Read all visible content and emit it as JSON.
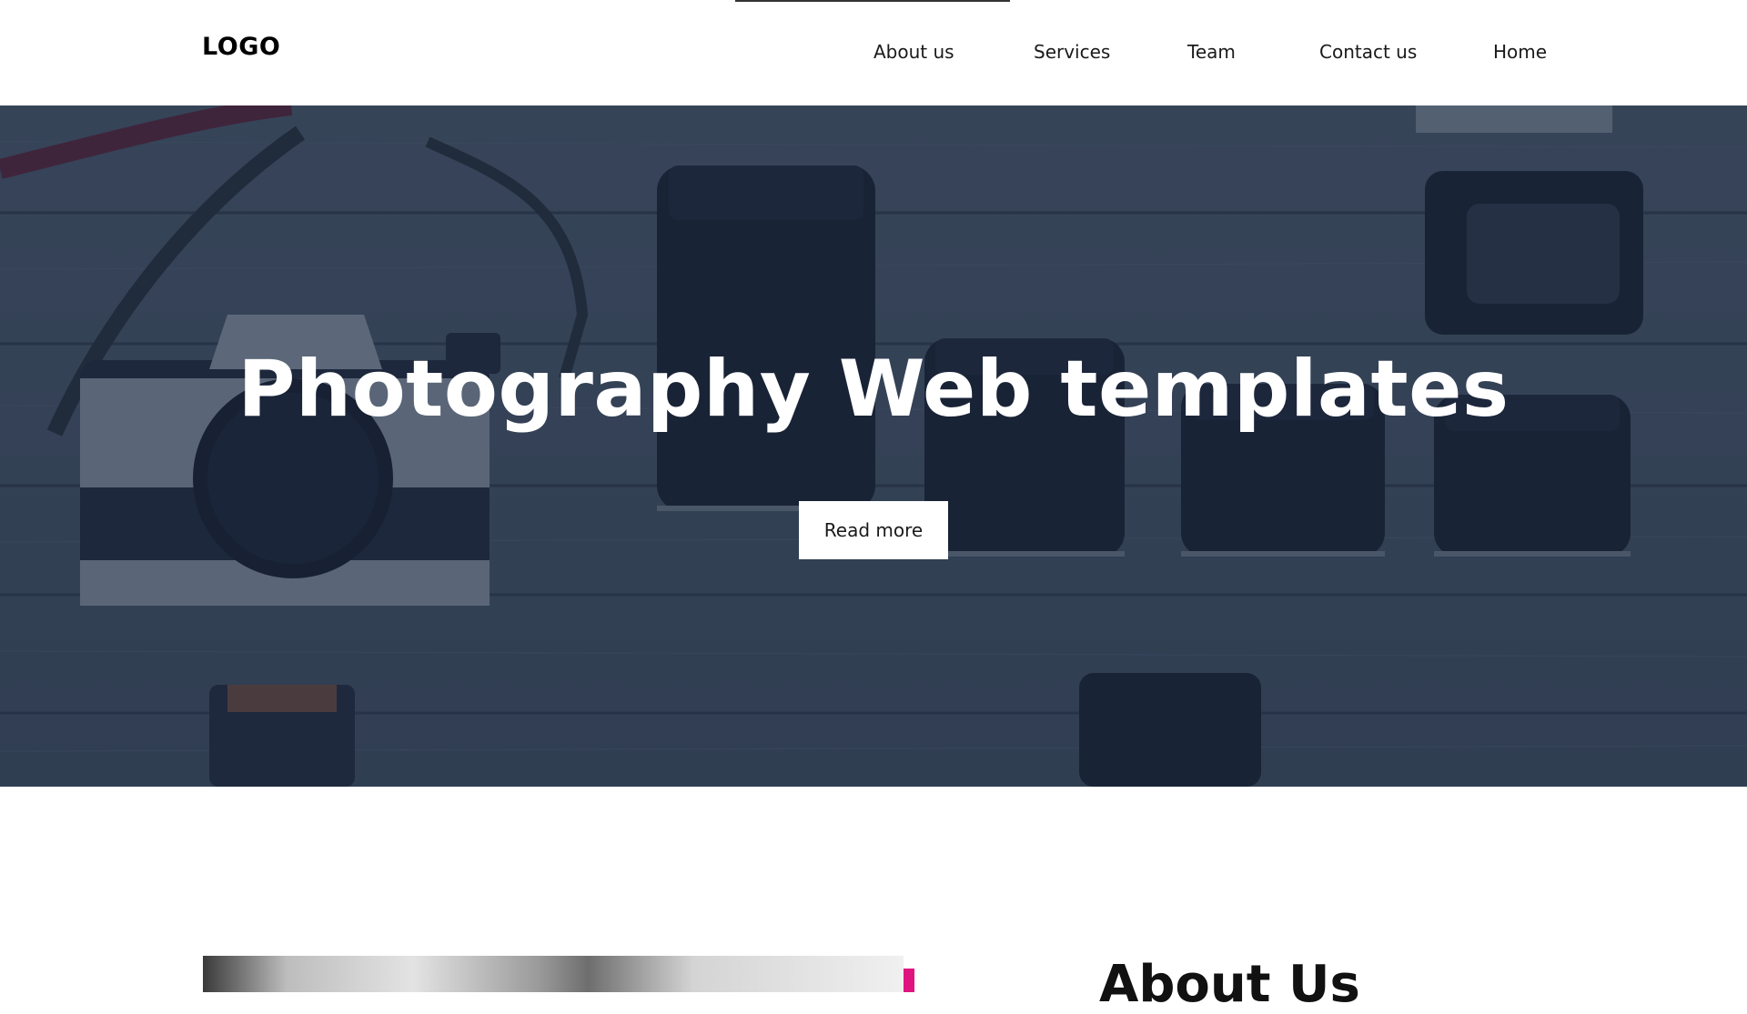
{
  "header": {
    "logo": "LOGO",
    "nav": [
      {
        "label": "About us"
      },
      {
        "label": "Services"
      },
      {
        "label": "Team"
      },
      {
        "label": "Contact us"
      },
      {
        "label": "Home"
      }
    ]
  },
  "hero": {
    "title": "Photography Web templates",
    "button_label": "Read more",
    "overlay_color": "#1f2d45"
  },
  "about": {
    "heading": "About Us",
    "accent_color": "#e0147f"
  }
}
